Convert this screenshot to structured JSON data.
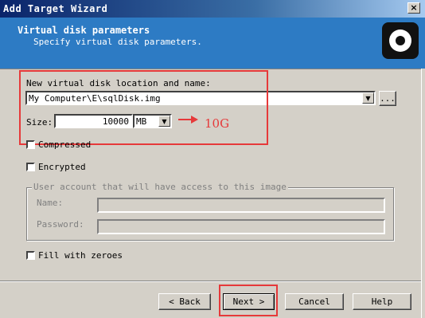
{
  "window": {
    "title": "Add Target Wizard",
    "close_glyph": "×"
  },
  "header": {
    "title": "Virtual disk parameters",
    "subtitle": "Specify virtual disk parameters.",
    "logo_icon": "target-logo-icon"
  },
  "form": {
    "location_label": "New virtual disk location and name:",
    "location_value": "My Computer\\E\\sqlDisk.img",
    "browse_label": "...",
    "size_label": "Size:",
    "size_value": "10000",
    "size_unit": "MB",
    "compressed_label": "Compressed",
    "compressed_checked": false,
    "encrypted_label": "Encrypted",
    "encrypted_checked": false,
    "account_group_label": "User account that will have access to this image",
    "name_label": "Name:",
    "name_value": "",
    "password_label": "Password:",
    "password_value": "",
    "fill_zeroes_label": "Fill with zeroes",
    "fill_zeroes_checked": false
  },
  "annotation": {
    "text": "10G",
    "color": "#e6393a"
  },
  "buttons": {
    "back": "< Back",
    "next": "Next >",
    "cancel": "Cancel",
    "help": "Help"
  },
  "colors": {
    "header_bg": "#2d7bc4",
    "titlebar_start": "#0a246a",
    "face": "#d4d0c8"
  }
}
